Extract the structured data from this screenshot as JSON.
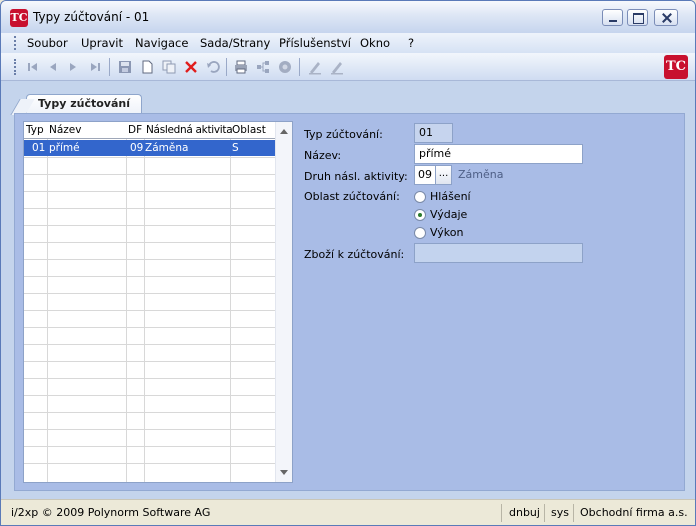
{
  "window": {
    "title": "Typy zúčtování - 01",
    "app_icon_text": "TC"
  },
  "menu": {
    "items": [
      "Soubor",
      "Upravit",
      "Navigace",
      "Sada/Strany",
      "Příslušenství",
      "Okno",
      "?"
    ]
  },
  "toolbar": {
    "icons": [
      "first-record-icon",
      "prev-record-icon",
      "next-record-icon",
      "last-record-icon",
      "save-icon",
      "new-icon",
      "copy-icon",
      "delete-icon",
      "undo-icon",
      "print-icon",
      "tree-icon",
      "help-circle-icon",
      "edit-icon",
      "edit-alt-icon"
    ],
    "accent": "#c8102e"
  },
  "tab": {
    "label": "Typy zúčtování"
  },
  "grid": {
    "headers": [
      "Typ",
      "Název",
      "DF",
      "Následná aktivita",
      "Oblast"
    ],
    "rows": [
      {
        "typ": "01",
        "nazev": "přímé",
        "df": "09",
        "aktivita": "Záměna",
        "oblast": "S"
      }
    ],
    "selection_color": "#3366cc"
  },
  "form": {
    "typ_label": "Typ zúčtování:",
    "typ_value": "01",
    "nazev_label": "Název:",
    "nazev_value": "přímé",
    "druh_label": "Druh násl. aktivity:",
    "druh_value": "09",
    "druh_button": "...",
    "druh_hint": "Záměna",
    "oblast_label": "Oblast zúčtování:",
    "oblast_options": [
      "Hlášení",
      "Výdaje",
      "Výkon"
    ],
    "oblast_selected": "Výdaje",
    "zbozi_label": "Zboží k zúčtování:",
    "zbozi_value": ""
  },
  "status": {
    "copyright": "i/2xp © 2009 Polynorm Software AG",
    "user": "dnbuj",
    "db": "sys",
    "company": "Obchodní firma a.s."
  }
}
